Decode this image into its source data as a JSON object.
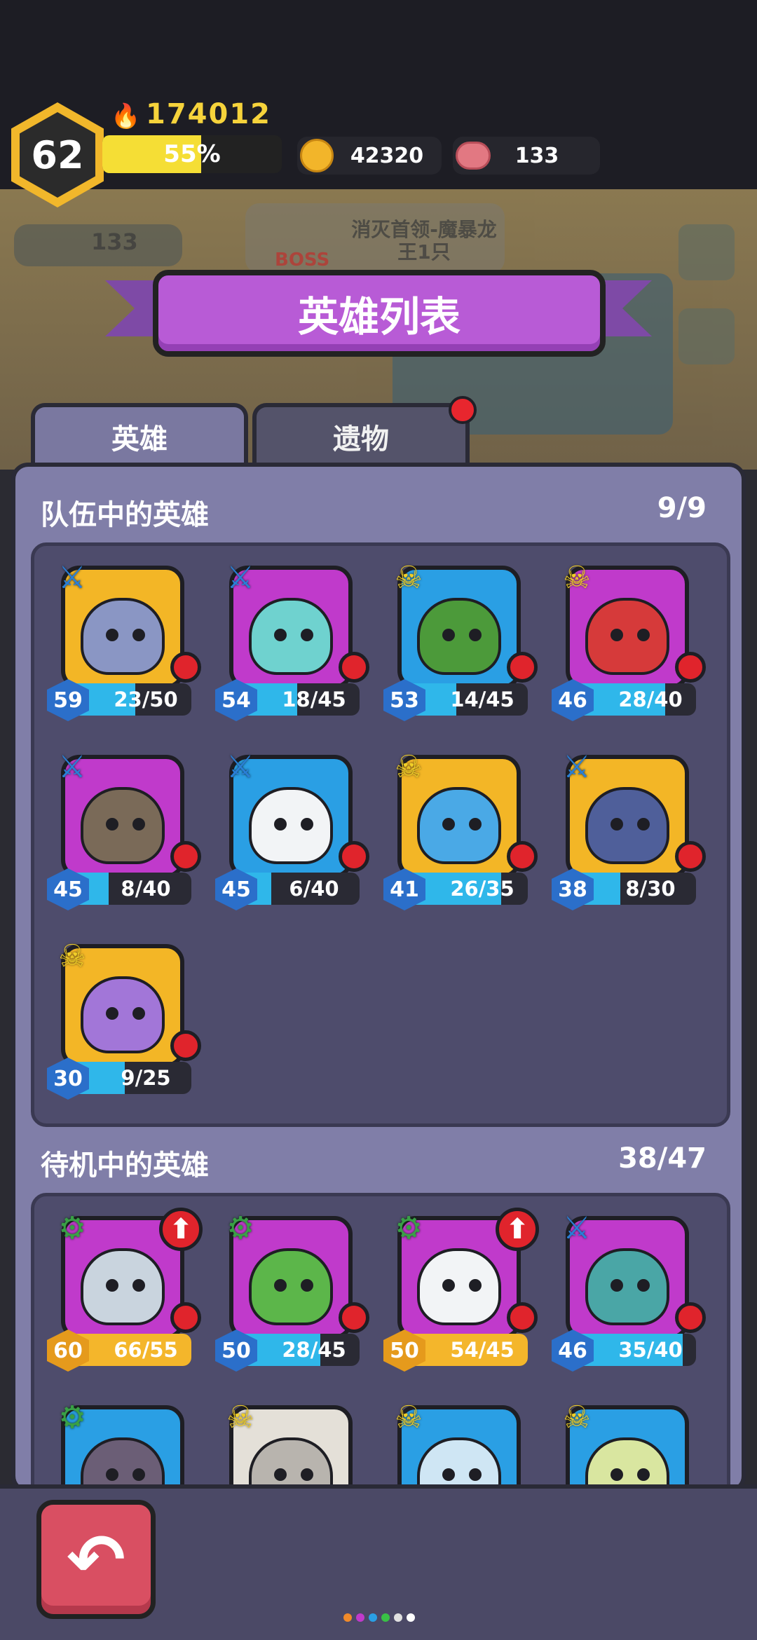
{
  "player": {
    "level": "62",
    "power": "174012",
    "xp_percent_label": "55%",
    "xp_fraction": 0.55,
    "gold": "42320",
    "meat": "133"
  },
  "background": {
    "quest_text": "消灭首领-魔暴龙王1只",
    "boss_label": "BOSS",
    "meat_count": "133"
  },
  "screen": {
    "title": "英雄列表"
  },
  "tabs": [
    {
      "label": "英雄",
      "active": true
    },
    {
      "label": "遗物",
      "active": false,
      "has_notification": true
    }
  ],
  "team": {
    "label": "队伍中的英雄",
    "count": "9/9",
    "heroes": [
      {
        "level": "59",
        "progress": "23/50",
        "ratio": 0.46,
        "class": "blue",
        "bg": "yellow",
        "face": "#8a96c4"
      },
      {
        "level": "54",
        "progress": "18/45",
        "ratio": 0.4,
        "class": "blue",
        "bg": "magenta",
        "face": "#6fd2cf"
      },
      {
        "level": "53",
        "progress": "14/45",
        "ratio": 0.31,
        "class": "yellow",
        "bg": "blue",
        "face": "#4c9a3a"
      },
      {
        "level": "46",
        "progress": "28/40",
        "ratio": 0.7,
        "class": "yellow",
        "bg": "magenta",
        "face": "#d63a3a"
      },
      {
        "level": "45",
        "progress": "8/40",
        "ratio": 0.2,
        "class": "blue",
        "bg": "magenta",
        "face": "#7a6a58"
      },
      {
        "level": "45",
        "progress": "6/40",
        "ratio": 0.15,
        "class": "blue",
        "bg": "blue",
        "face": "#f2f4f6"
      },
      {
        "level": "41",
        "progress": "26/35",
        "ratio": 0.74,
        "class": "yellow",
        "bg": "yellow",
        "face": "#4aa9e6"
      },
      {
        "level": "38",
        "progress": "8/30",
        "ratio": 0.27,
        "class": "blue",
        "bg": "yellow",
        "face": "#4f5f9a"
      },
      {
        "level": "30",
        "progress": "9/25",
        "ratio": 0.36,
        "class": "yellow",
        "bg": "yellow",
        "face": "#a276d8"
      }
    ]
  },
  "standby": {
    "label": "待机中的英雄",
    "count": "38/47",
    "heroes": [
      {
        "level": "60",
        "progress": "66/55",
        "ratio": 1.0,
        "class": "green",
        "bg": "magenta",
        "face": "#c9d4de",
        "upgrade": true,
        "gold": true
      },
      {
        "level": "50",
        "progress": "28/45",
        "ratio": 0.62,
        "class": "green",
        "bg": "magenta",
        "face": "#5cb64a",
        "upgrade": false,
        "gold": false
      },
      {
        "level": "50",
        "progress": "54/45",
        "ratio": 1.0,
        "class": "green",
        "bg": "magenta",
        "face": "#f2f4f6",
        "upgrade": true,
        "gold": true
      },
      {
        "level": "46",
        "progress": "35/40",
        "ratio": 0.87,
        "class": "blue",
        "bg": "magenta",
        "face": "#4aa6a6",
        "upgrade": false,
        "gold": false
      },
      {
        "class": "green",
        "bg": "blue",
        "face": "#6b5e76"
      },
      {
        "class": "yellow",
        "bg": "white",
        "face": "#b8b4ae"
      },
      {
        "class": "yellow",
        "bg": "blue",
        "face": "#cfe6f4"
      },
      {
        "class": "yellow",
        "bg": "blue",
        "face": "#d9e6a0"
      }
    ]
  },
  "icons": {
    "class_blue": "crossed-swords-icon",
    "class_yellow": "crossed-bones-icon",
    "class_green": "gear-skull-icon",
    "back": "back-arrow-icon"
  },
  "pager_colors": [
    "#f08a2a",
    "#c03acb",
    "#2a9fe4",
    "#39c046",
    "#e0e0e0",
    "#ffffff"
  ]
}
